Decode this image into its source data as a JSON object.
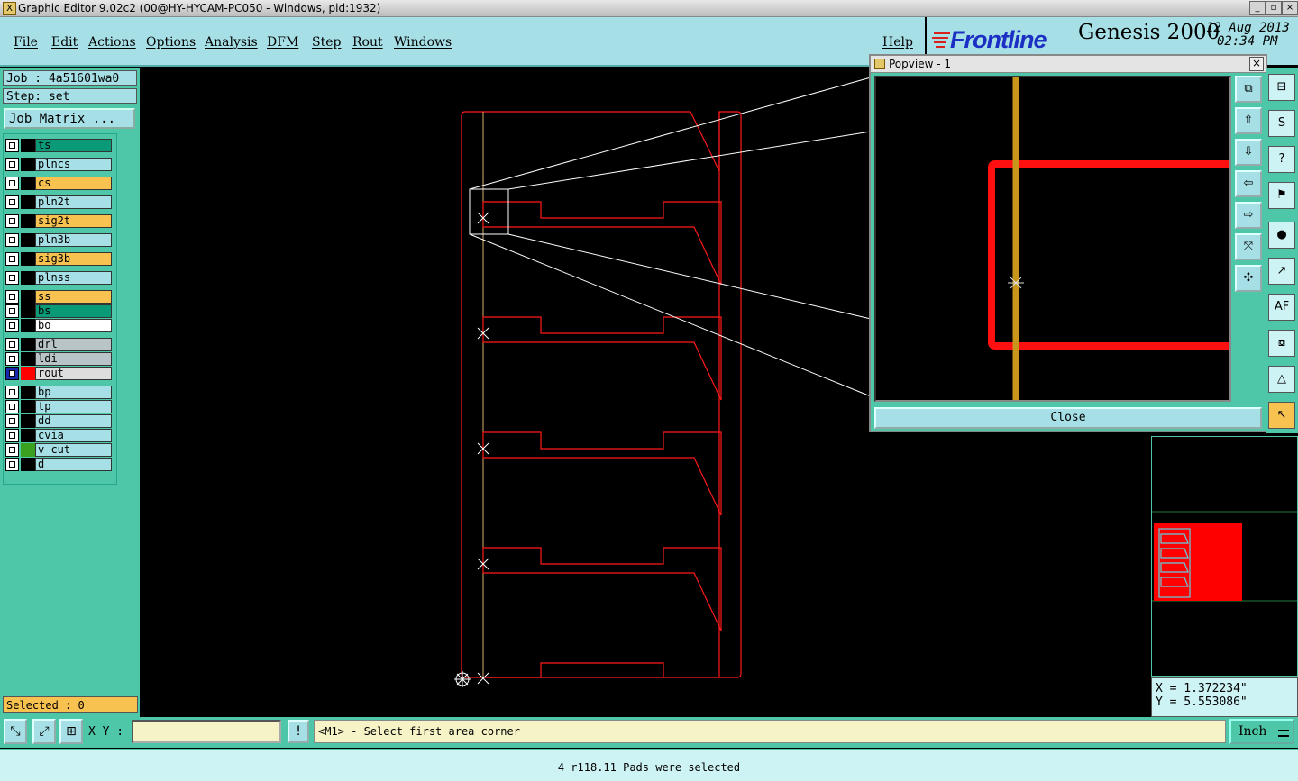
{
  "window": {
    "title": "Graphic Editor 9.02c2 (00@HY-HYCAM-PC050 - Windows, pid:1932)",
    "min_label": "_",
    "restore_label": "▫",
    "close_label": "×"
  },
  "menu": {
    "items": [
      "File",
      "Edit",
      "Actions",
      "Options",
      "Analysis",
      "DFM",
      "Step",
      "Rout",
      "Windows"
    ],
    "help": "Help"
  },
  "header": {
    "brand": "Frontline",
    "product": "Genesis 2000",
    "date": "12 Aug 2013",
    "time": "02:34 PM",
    "colors": {
      "brand": "#1c2fc4",
      "brand_accent": "#d8201c"
    }
  },
  "job": {
    "job_label": "Job : 4a51601wa0",
    "step_label": "Step: set",
    "matrix_button": "Job Matrix ..."
  },
  "layers": [
    {
      "name": "ts",
      "color": "#0a9a78",
      "swatch": ""
    },
    {
      "name": "plncs",
      "color": "#a6e0e6",
      "swatch": ""
    },
    {
      "name": "cs",
      "color": "#f8c250",
      "swatch": ""
    },
    {
      "name": "pln2t",
      "color": "#a6e0e6",
      "swatch": ""
    },
    {
      "name": "sig2t",
      "color": "#f8c250",
      "swatch": ""
    },
    {
      "name": "pln3b",
      "color": "#a6e0e6",
      "swatch": ""
    },
    {
      "name": "sig3b",
      "color": "#f8c250",
      "swatch": ""
    },
    {
      "name": "plnss",
      "color": "#a6e0e6",
      "swatch": ""
    },
    {
      "name": "ss",
      "color": "#f8c250",
      "swatch": ""
    },
    {
      "name": "bs",
      "color": "#0a9a78",
      "swatch": ""
    },
    {
      "name": "bo",
      "color": "#ffffff",
      "swatch": ""
    },
    {
      "name": "drl",
      "color": "#b9c4c8",
      "swatch": ""
    },
    {
      "name": "ldi",
      "color": "#b9c4c8",
      "swatch": ""
    },
    {
      "name": "rout",
      "color": "#dddddd",
      "swatch": "#ff0000"
    },
    {
      "name": "bp",
      "color": "#a6e0e6",
      "swatch": ""
    },
    {
      "name": "tp",
      "color": "#a6e0e6",
      "swatch": ""
    },
    {
      "name": "dd",
      "color": "#a6e0e6",
      "swatch": ""
    },
    {
      "name": "cvia",
      "color": "#a6e0e6",
      "swatch": ""
    },
    {
      "name": "v-cut",
      "color": "#a6e0e6",
      "swatch": "#3aa020"
    },
    {
      "name": "d",
      "color": "#a6e0e6",
      "swatch": ""
    }
  ],
  "selected_label": "Selected : 0",
  "toolbar": {
    "xy_label": "X Y :",
    "xy_value": "",
    "excl": "!",
    "prompt": "<M1> - Select first area corner",
    "unit": "Inch"
  },
  "status_text": "4 r118.11 Pads were selected",
  "popview": {
    "title": "Popview - 1",
    "close_button": "Close",
    "close_icon": "×"
  },
  "coords": {
    "x": "X = 1.372234\"",
    "y": "Y = 5.553086\""
  },
  "colors": {
    "profile": "#ff0000",
    "rout": "#ff1010",
    "vcut": "#c8961a",
    "panel": "#4ec6a8",
    "menu": "#a6e0e6"
  }
}
